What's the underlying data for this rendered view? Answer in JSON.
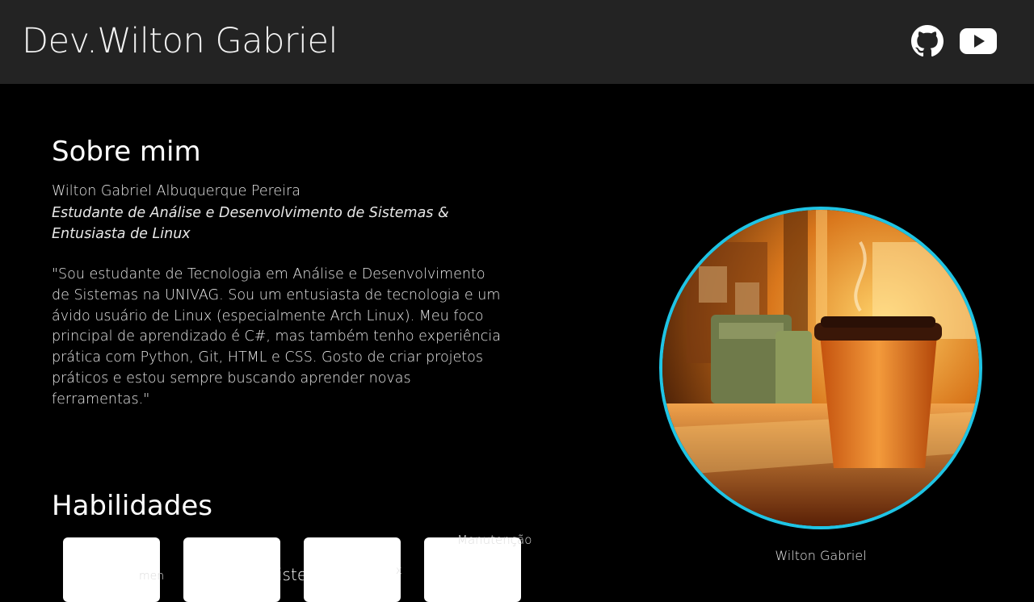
{
  "header": {
    "brand": "Dev.Wilton Gabriel",
    "links": [
      {
        "name": "GitHub",
        "icon": "github-icon"
      },
      {
        "name": "YouTube",
        "icon": "youtube-icon"
      }
    ]
  },
  "about": {
    "title": "Sobre mim",
    "name": "Wilton Gabriel Albuquerque Pereira",
    "role": "Estudante de Análise e Desenvolvimento de Sistemas & Entusiasta de Linux",
    "bio": "\"Sou estudante de Tecnologia em Análise e Desenvolvimento de Sistemas na UNIVAG. Sou um entusiasta de tecnologia e um ávido usuário de Linux (especialmente Arch Linux). Meu foco principal de aprendizado é C#, mas também tenho experiência prática com Python, Git, HTML e CSS. Gosto de criar projetos práticos e estou sempre buscando aprender novas ferramentas.\""
  },
  "skills": {
    "title": "Habilidades",
    "overflow_fragments": [
      "Manutenção",
      "x",
      "men",
      "iste"
    ]
  },
  "profile": {
    "caption": "Wilton Gabriel"
  },
  "colors": {
    "header_bg": "#232323",
    "page_bg": "#000000",
    "avatar_border": "#1fc4e4"
  }
}
